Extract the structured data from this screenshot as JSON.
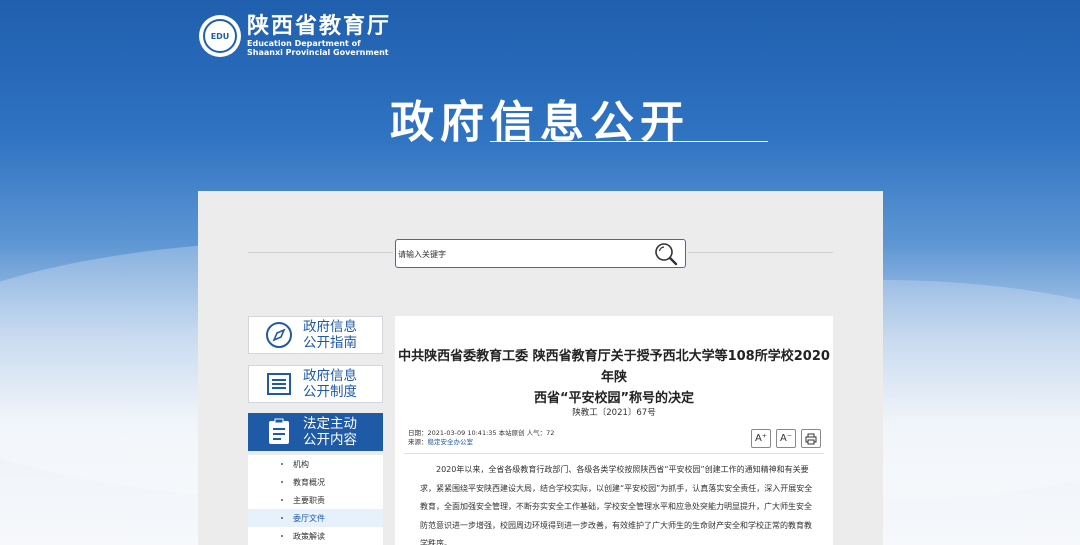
{
  "header": {
    "org_cn": "陕西省教育厅",
    "org_en_line1": "Education Department of",
    "org_en_line2": "Shaanxi Provincial Government",
    "emblem_text": "EDU"
  },
  "hero": {
    "title": "政府信息公开"
  },
  "search": {
    "placeholder": "请输入关键字",
    "button_icon": "search-icon"
  },
  "sidebar": {
    "cards": [
      {
        "label_1": "政府信息",
        "label_2": "公开指南",
        "icon": "compass-icon",
        "active": false
      },
      {
        "label_1": "政府信息",
        "label_2": "公开制度",
        "icon": "list-icon",
        "active": false
      },
      {
        "label_1": "法定主动",
        "label_2": "公开内容",
        "icon": "clipboard-icon",
        "active": true
      }
    ],
    "items": [
      {
        "label": "机构",
        "active": false
      },
      {
        "label": "教育概况",
        "active": false
      },
      {
        "label": "主要职责",
        "active": false
      },
      {
        "label": "委厅文件",
        "active": true
      },
      {
        "label": "政策解读",
        "active": false
      }
    ]
  },
  "article": {
    "title_line1": "中共陕西省委教育工委 陕西省教育厅关于授予西北大学等108所学校2020年陕",
    "title_line2": "西省“平安校园”称号的决定",
    "doc_number": "陕教工〔2021〕67号",
    "meta_line1": "日期：2021-03-09 10:41:35   本站原创   人气：72",
    "meta_source_label": "来源：",
    "meta_source": "稳定安全办公室",
    "tools": {
      "font_larger": "A⁺",
      "font_smaller": "A⁻",
      "print_icon": "print-icon"
    },
    "body": "2020年以来，全省各级教育行政部门、各级各类学校按照陕西省“平安校园”创建工作的通知精神和有关要求，紧紧围绕平安陕西建设大局，结合学校实际，以创建“平安校园”为抓手，认真落实安全责任，深入开展安全教育，全面加强安全管理，不断夯实安全工作基础，学校安全管理水平和应急处突能力明显提升，广大师生安全防范意识进一步增强，校园周边环境得到进一步改善，有效维护了广大师生的生命财产安全和学校正常的教育教学秩序。"
  },
  "colors": {
    "brand_blue": "#1e5aa6",
    "panel_gray": "#ececec"
  }
}
